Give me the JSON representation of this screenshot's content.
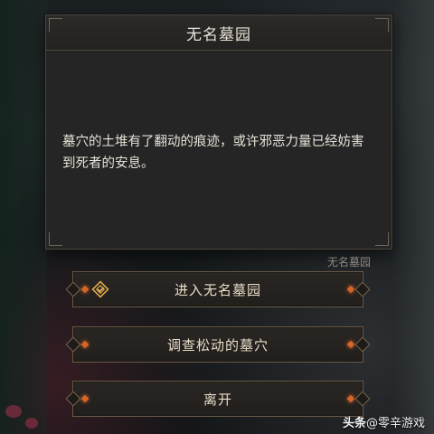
{
  "dialog": {
    "title": "无名墓园",
    "body": "墓穴的土堆有了翻动的痕迹，或许邪恶力量已经妨害到死者的安息。"
  },
  "location_caption": "无名墓园",
  "options": [
    {
      "label": "进入无名墓园",
      "icon": "quest-marker-icon"
    },
    {
      "label": "调查松动的墓穴"
    },
    {
      "label": "离开"
    }
  ],
  "watermark": {
    "prefix": "头条",
    "handle": "@零辛游戏"
  },
  "colors": {
    "accent_orange": "#d9642b",
    "text_primary": "#e8e2d6",
    "border_gold": "#6b5a45"
  }
}
